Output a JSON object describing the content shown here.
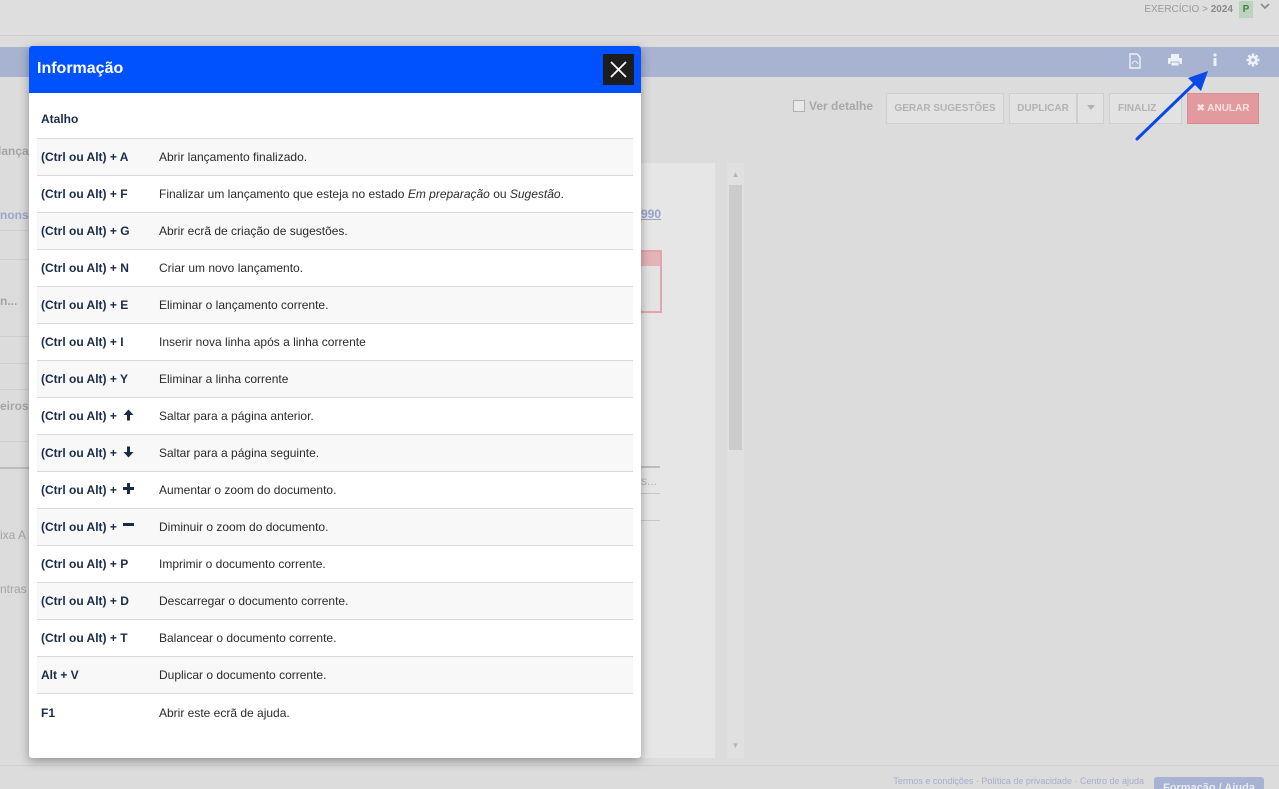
{
  "app": {
    "exercicio_label": "EXERCÍCIO >",
    "exercicio_year": "2024",
    "profile_badge": "P",
    "toolbar_icons": [
      "pdf-icon",
      "print-icon",
      "info-icon",
      "gear-icon"
    ],
    "ver_detalhe_label": "Ver detalhe",
    "buttons": {
      "gerar_sugestoes": "GERAR SUGESTÕES",
      "duplicar": "DUPLICAR",
      "finalizar": "FINALIZ",
      "anular": "✖ ANULAR"
    },
    "left_fragments": [
      "lançam",
      "nons",
      "n...",
      "eiros",
      "ixa A",
      "ntras"
    ],
    "doc_number_fragment": "990",
    "doc_fragment_dots": "s...",
    "footer_links": "Termos e condições · Política de privacidade · Centro de ajuda",
    "footer_button": "Formação / Ajuda"
  },
  "modal": {
    "title": "Informação",
    "header_key": "Atalho",
    "rows": [
      {
        "key": "(Ctrl ou Alt) + A",
        "desc": "Abrir lançamento finalizado."
      },
      {
        "key": "(Ctrl ou Alt) + F",
        "desc_pre": "Finalizar um lançamento que esteja no estado ",
        "desc_em1": "Em preparação",
        "desc_mid": " ou ",
        "desc_em2": "Sugestão",
        "desc_post": "."
      },
      {
        "key": "(Ctrl ou Alt) + G",
        "desc": "Abrir ecrã de criação de sugestões."
      },
      {
        "key": "(Ctrl ou Alt) + N",
        "desc": "Criar um novo lançamento."
      },
      {
        "key": "(Ctrl ou Alt) + E",
        "desc": "Eliminar o lançamento corrente."
      },
      {
        "key": "(Ctrl ou Alt) + I",
        "desc": "Inserir nova linha após a linha corrente"
      },
      {
        "key": "(Ctrl ou Alt) + Y",
        "desc": "Eliminar a linha corrente"
      },
      {
        "key": "(Ctrl ou Alt) +",
        "icon": "arrow-up-icon",
        "desc": "Saltar para a página anterior."
      },
      {
        "key": "(Ctrl ou Alt) +",
        "icon": "arrow-down-icon",
        "desc": "Saltar para a página seguinte."
      },
      {
        "key": "(Ctrl ou Alt) +",
        "icon": "plus-icon",
        "desc": "Aumentar o zoom do documento."
      },
      {
        "key": "(Ctrl ou Alt) +",
        "icon": "minus-icon",
        "desc": "Diminuir o zoom do documento."
      },
      {
        "key": "(Ctrl ou Alt) + P",
        "desc": "Imprimir o documento corrente."
      },
      {
        "key": "(Ctrl ou Alt) + D",
        "desc": "Descarregar o documento corrente."
      },
      {
        "key": "(Ctrl ou Alt) + T",
        "desc": "Balancear o documento corrente."
      },
      {
        "key": "Alt + V",
        "desc": "Duplicar o documento corrente."
      },
      {
        "key": "F1",
        "desc": "Abrir este ecrã de ajuda."
      }
    ]
  },
  "colors": {
    "modal_header": "#0052ff",
    "close_button": "#1d1d1d",
    "annotation_arrow": "#0a49e8"
  }
}
